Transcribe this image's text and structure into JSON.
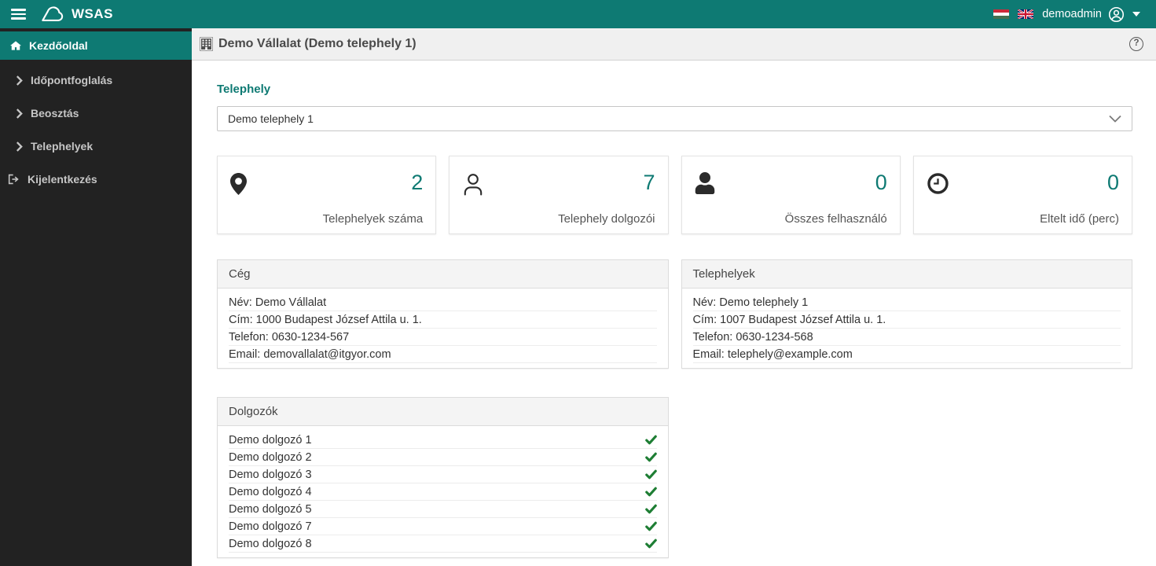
{
  "topbar": {
    "brand": "WSAS",
    "user_name": "demoadmin"
  },
  "sidebar": {
    "items": [
      {
        "label": "Kezdőoldal",
        "icon": "home-icon",
        "active": true
      },
      {
        "label": "Időpontfoglalás",
        "icon": "chevron-right-icon",
        "active": false
      },
      {
        "label": "Beosztás",
        "icon": "chevron-right-icon",
        "active": false
      },
      {
        "label": "Telephelyek",
        "icon": "chevron-right-icon",
        "active": false
      },
      {
        "label": "Kijelentkezés",
        "icon": "sign-out-icon",
        "active": false
      }
    ]
  },
  "content_header": {
    "title": "Demo Vállalat (Demo telephely 1)",
    "title_icon": "building-icon"
  },
  "site_selector": {
    "heading": "Telephely",
    "selected": "Demo telephely 1"
  },
  "stat_cards": [
    {
      "icon": "map-marker-icon",
      "value": "2",
      "label": "Telephelyek száma"
    },
    {
      "icon": "user-outline-icon",
      "value": "7",
      "label": "Telephely dolgozói"
    },
    {
      "icon": "user-filled-icon",
      "value": "0",
      "label": "Összes felhasználó"
    },
    {
      "icon": "clock-icon",
      "value": "0",
      "label": "Eltelt idő (perc)"
    }
  ],
  "company_panel": {
    "title": "Cég",
    "rows": [
      "Név: Demo Vállalat",
      "Cím: 1000 Budapest József Attila u. 1.",
      "Telefon: 0630-1234-567",
      "Email: demovallalat@itgyor.com"
    ]
  },
  "site_panel": {
    "title": "Telephelyek",
    "rows": [
      "Név: Demo telephely 1",
      "Cím: 1007 Budapest József Attila u. 1.",
      "Telefon: 0630-1234-568",
      "Email: telephely@example.com"
    ]
  },
  "workers_panel": {
    "title": "Dolgozók",
    "rows": [
      "Demo dolgozó 1",
      "Demo dolgozó 2",
      "Demo dolgozó 3",
      "Demo dolgozó 4",
      "Demo dolgozó 5",
      "Demo dolgozó 7",
      "Demo dolgozó 8"
    ],
    "row_status_icon": "check-icon"
  },
  "icons": {
    "help": "?"
  },
  "colors": {
    "accent_teal": "#0E7A73",
    "sidebar_bg": "#222222",
    "check_green": "#1E7E34",
    "header_bar_bg": "#F0F0F0"
  }
}
